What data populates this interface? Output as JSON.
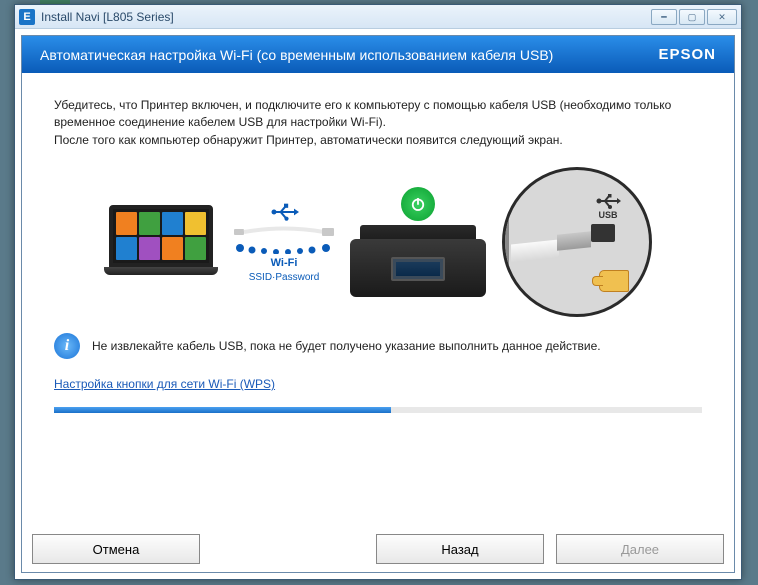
{
  "window": {
    "icon_letter": "E",
    "title": "Install Navi [L805 Series]"
  },
  "header": {
    "title": "Автоматическая настройка Wi-Fi (со временным использованием кабеля USB)",
    "brand": "EPSON"
  },
  "instructions": {
    "line1": "Убедитесь, что Принтер включен, и подключите его к компьютеру с помощью кабеля USB (необходимо только временное соединение кабелем USB для настройки Wi-Fi).",
    "line2": "После того как компьютер обнаружит Принтер, автоматически появится следующий экран."
  },
  "diagram": {
    "wifi_label": "Wi-Fi",
    "wifi_sub": "SSID·Password",
    "usb_zoom_label": "USB"
  },
  "warning": {
    "text": "Не извлекайте кабель USB, пока не будет получено указание выполнить данное действие."
  },
  "link": {
    "wps": "Настройка кнопки для сети Wi-Fi (WPS)"
  },
  "buttons": {
    "cancel": "Отмена",
    "back": "Назад",
    "next": "Далее"
  },
  "progress": {
    "percent": 52
  }
}
